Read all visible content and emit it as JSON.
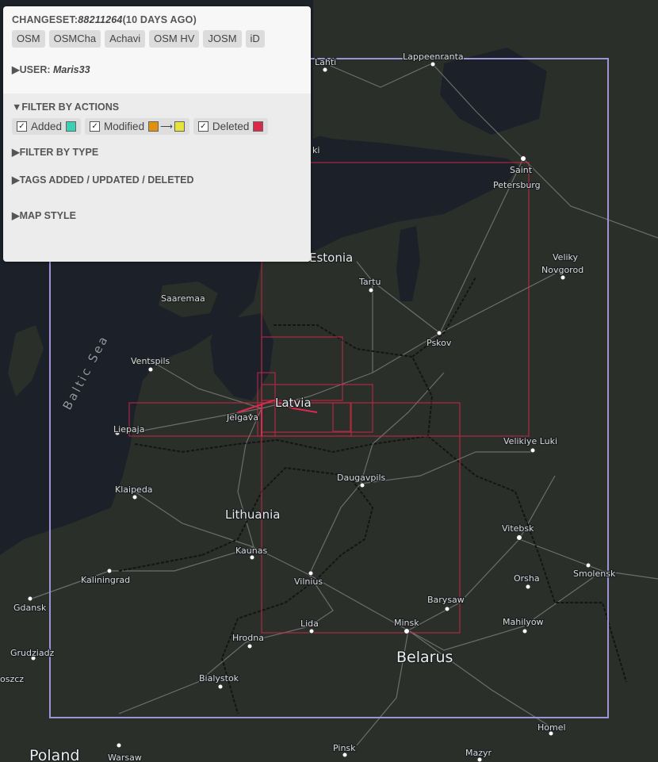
{
  "panel": {
    "changeset_label": "CHANGESET:",
    "changeset_id": "88211264",
    "changeset_age": "(10 DAYS AGO)",
    "links": [
      "OSM",
      "OSMCha",
      "Achavi",
      "OSM HV",
      "JOSM",
      "iD"
    ],
    "user_toggle": "▶USER: ",
    "user_name": "Maris33",
    "filter_actions_toggle": "▼FILTER BY ACTIONS",
    "actions": [
      {
        "label": "Added",
        "checked": true,
        "color": "#3ad1b3"
      },
      {
        "label": "Modified",
        "checked": true,
        "color_from": "#e0920e",
        "color_to": "#e8e33a"
      },
      {
        "label": "Deleted",
        "checked": true,
        "color": "#d9284a"
      }
    ],
    "filter_type_toggle": "▶FILTER BY TYPE",
    "tags_toggle": "▶TAGS ADDED / UPDATED / DELETED",
    "map_style_toggle": "▶MAP STYLE",
    "checkbox_mark": "✓",
    "arrow_glyph": "⟶"
  },
  "map": {
    "colors": {
      "land": "#2b2f29",
      "water": "#1c2129",
      "bbox": "#9f93d6",
      "deleted": "#d9284a",
      "road": "#7d7d7d",
      "border": "#141414"
    },
    "country_labels": [
      "Estonia",
      "Latvia",
      "Lithuania",
      "Belarus",
      "Poland"
    ],
    "sea_label": "Baltic Sea",
    "places": [
      "Lahti",
      "Lappeenranta",
      "ki",
      "Saint",
      "Petersburg",
      "Veliky",
      "Novgorod",
      "Tartu",
      "Saaremaa",
      "Pskov",
      "Ventspils",
      "Jelgava",
      "Liepaja",
      "Velikiye Luki",
      "Daugavpils",
      "Klaipeda",
      "Vitebsk",
      "Kaunas",
      "Smolensk",
      "Kaliningrad",
      "Vilnius",
      "Orsha",
      "Gdansk",
      "Barysaw",
      "Lida",
      "Minsk",
      "Mahilyow",
      "Hrodna",
      "Grudziadz",
      "oszcz",
      "Bialystok",
      "Homel",
      "Warsaw",
      "Pinsk",
      "Mazyr"
    ]
  }
}
